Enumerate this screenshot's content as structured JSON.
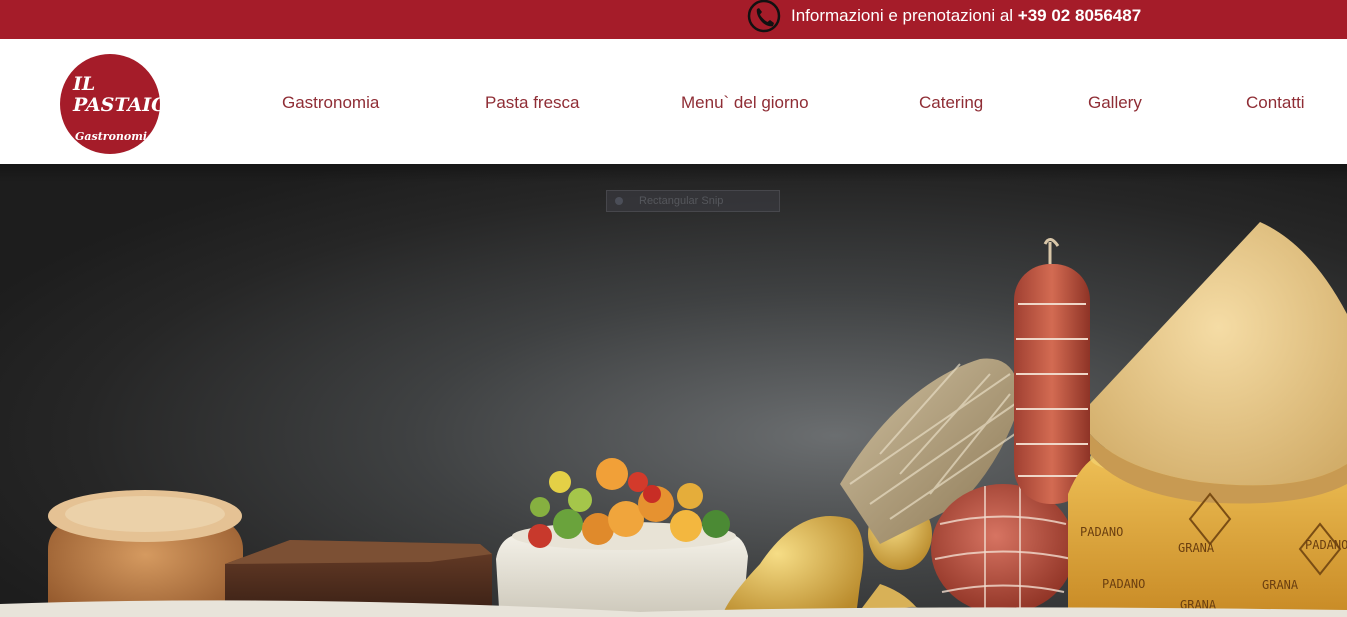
{
  "topbar": {
    "info_text": "Informazioni e prenotazioni al ",
    "phone_number": "+39 02 8056487",
    "phone_icon": "phone-icon",
    "background_color": "#a51c29"
  },
  "logo": {
    "line1": "IL",
    "line2": "PASTAIO",
    "subtitle": "Gastronomia"
  },
  "nav": {
    "items": [
      {
        "label": "Gastronomia"
      },
      {
        "label": "Pasta fresca"
      },
      {
        "label": "Menu` del giorno"
      },
      {
        "label": "Catering"
      },
      {
        "label": "Gallery"
      },
      {
        "label": "Contatti"
      }
    ],
    "text_color": "#8f2d35"
  },
  "hero": {
    "overlay_label": "Rectangular Snip",
    "cheese_stamps": [
      "PADANO",
      "GRANA",
      "GRANA",
      "PADANO",
      "PADANO",
      "GRANA"
    ]
  }
}
